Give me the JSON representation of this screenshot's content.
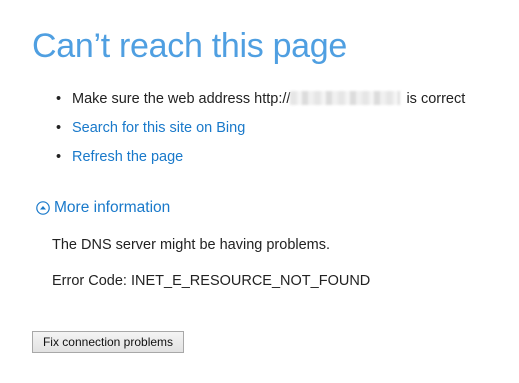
{
  "title": "Can’t reach this page",
  "suggestions": [
    {
      "prefix": "Make sure the web address http://",
      "suffix": " is correct"
    },
    {
      "label": "Search for this site on Bing"
    },
    {
      "label": "Refresh the page"
    }
  ],
  "more_information": {
    "label": "More information",
    "icon": "chevron-up-circle-icon"
  },
  "details": {
    "dns_message": "The DNS server might be having problems.",
    "error_code": "Error Code: INET_E_RESOURCE_NOT_FOUND"
  },
  "buttons": {
    "fix_connection": "Fix connection problems"
  },
  "colors": {
    "title": "#4f9fe1",
    "link": "#1979ca",
    "body_text": "#222222"
  }
}
